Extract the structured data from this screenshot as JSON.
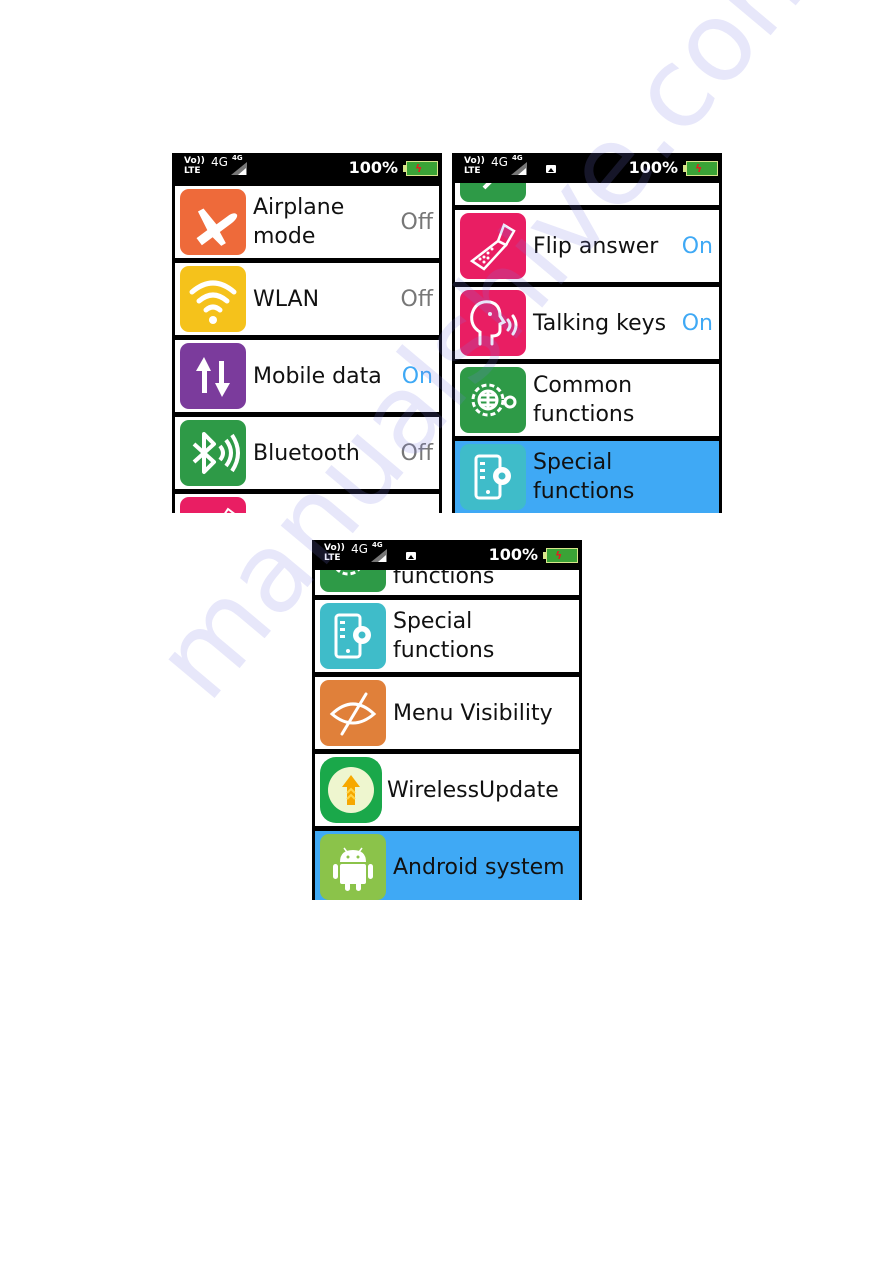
{
  "status_bar": {
    "volte_top": "Vo))",
    "volte_bottom": "LTE",
    "network": "4G",
    "network_small": "4G",
    "battery_percent": "100%",
    "battery_level": 1.0,
    "battery_icon": "battery-charging-icon"
  },
  "colors": {
    "selected_row": "#3fa9f5",
    "status_on": "#3fa9f5",
    "status_off": "#777777"
  },
  "screens": [
    {
      "items": [
        {
          "label": "Airplane mode",
          "status": "Off",
          "icon": "airplane-icon",
          "icon_color": "#ee6a3a"
        },
        {
          "label": "WLAN",
          "status": "Off",
          "icon": "wifi-icon",
          "icon_color": "#f5c21b"
        },
        {
          "label": "Mobile data",
          "status": "On",
          "icon": "data-arrows-icon",
          "icon_color": "#7b3b9c"
        },
        {
          "label": "Bluetooth",
          "status": "Off",
          "icon": "bluetooth-icon",
          "icon_color": "#2e9a47"
        },
        {
          "label": "",
          "status": "",
          "icon": "flip-phone-icon",
          "icon_color": "#e91e63"
        }
      ]
    },
    {
      "items": [
        {
          "label": "",
          "status": "",
          "icon": "bluetooth-icon",
          "icon_color": "#2e9a47"
        },
        {
          "label": "Flip answer",
          "status": "On",
          "icon": "flip-phone-icon",
          "icon_color": "#e91e63"
        },
        {
          "label": "Talking keys",
          "status": "On",
          "icon": "talking-head-icon",
          "icon_color": "#e91e63"
        },
        {
          "label": "Common functions",
          "status": "",
          "icon": "globe-gear-icon",
          "icon_color": "#2e9a47"
        },
        {
          "label": "Special functions",
          "status": "",
          "icon": "phone-gear-icon",
          "icon_color": "#3fbcc9",
          "selected": true
        }
      ]
    },
    {
      "items": [
        {
          "label": "functions",
          "status": "",
          "icon": "globe-gear-icon",
          "icon_color": "#2e9a47"
        },
        {
          "label": "Special functions",
          "status": "",
          "icon": "phone-gear-icon",
          "icon_color": "#3fbcc9"
        },
        {
          "label": "Menu Visibility",
          "status": "",
          "icon": "eye-slash-icon",
          "icon_color": "#e0803a"
        },
        {
          "label": "WirelessUpdate",
          "status": "",
          "icon": "update-arrow-icon",
          "icon_color": "#1aa84a"
        },
        {
          "label": "Android system",
          "status": "",
          "icon": "android-icon",
          "icon_color": "#8bc34a",
          "selected": true
        }
      ]
    }
  ],
  "watermark": "manualshive.com"
}
